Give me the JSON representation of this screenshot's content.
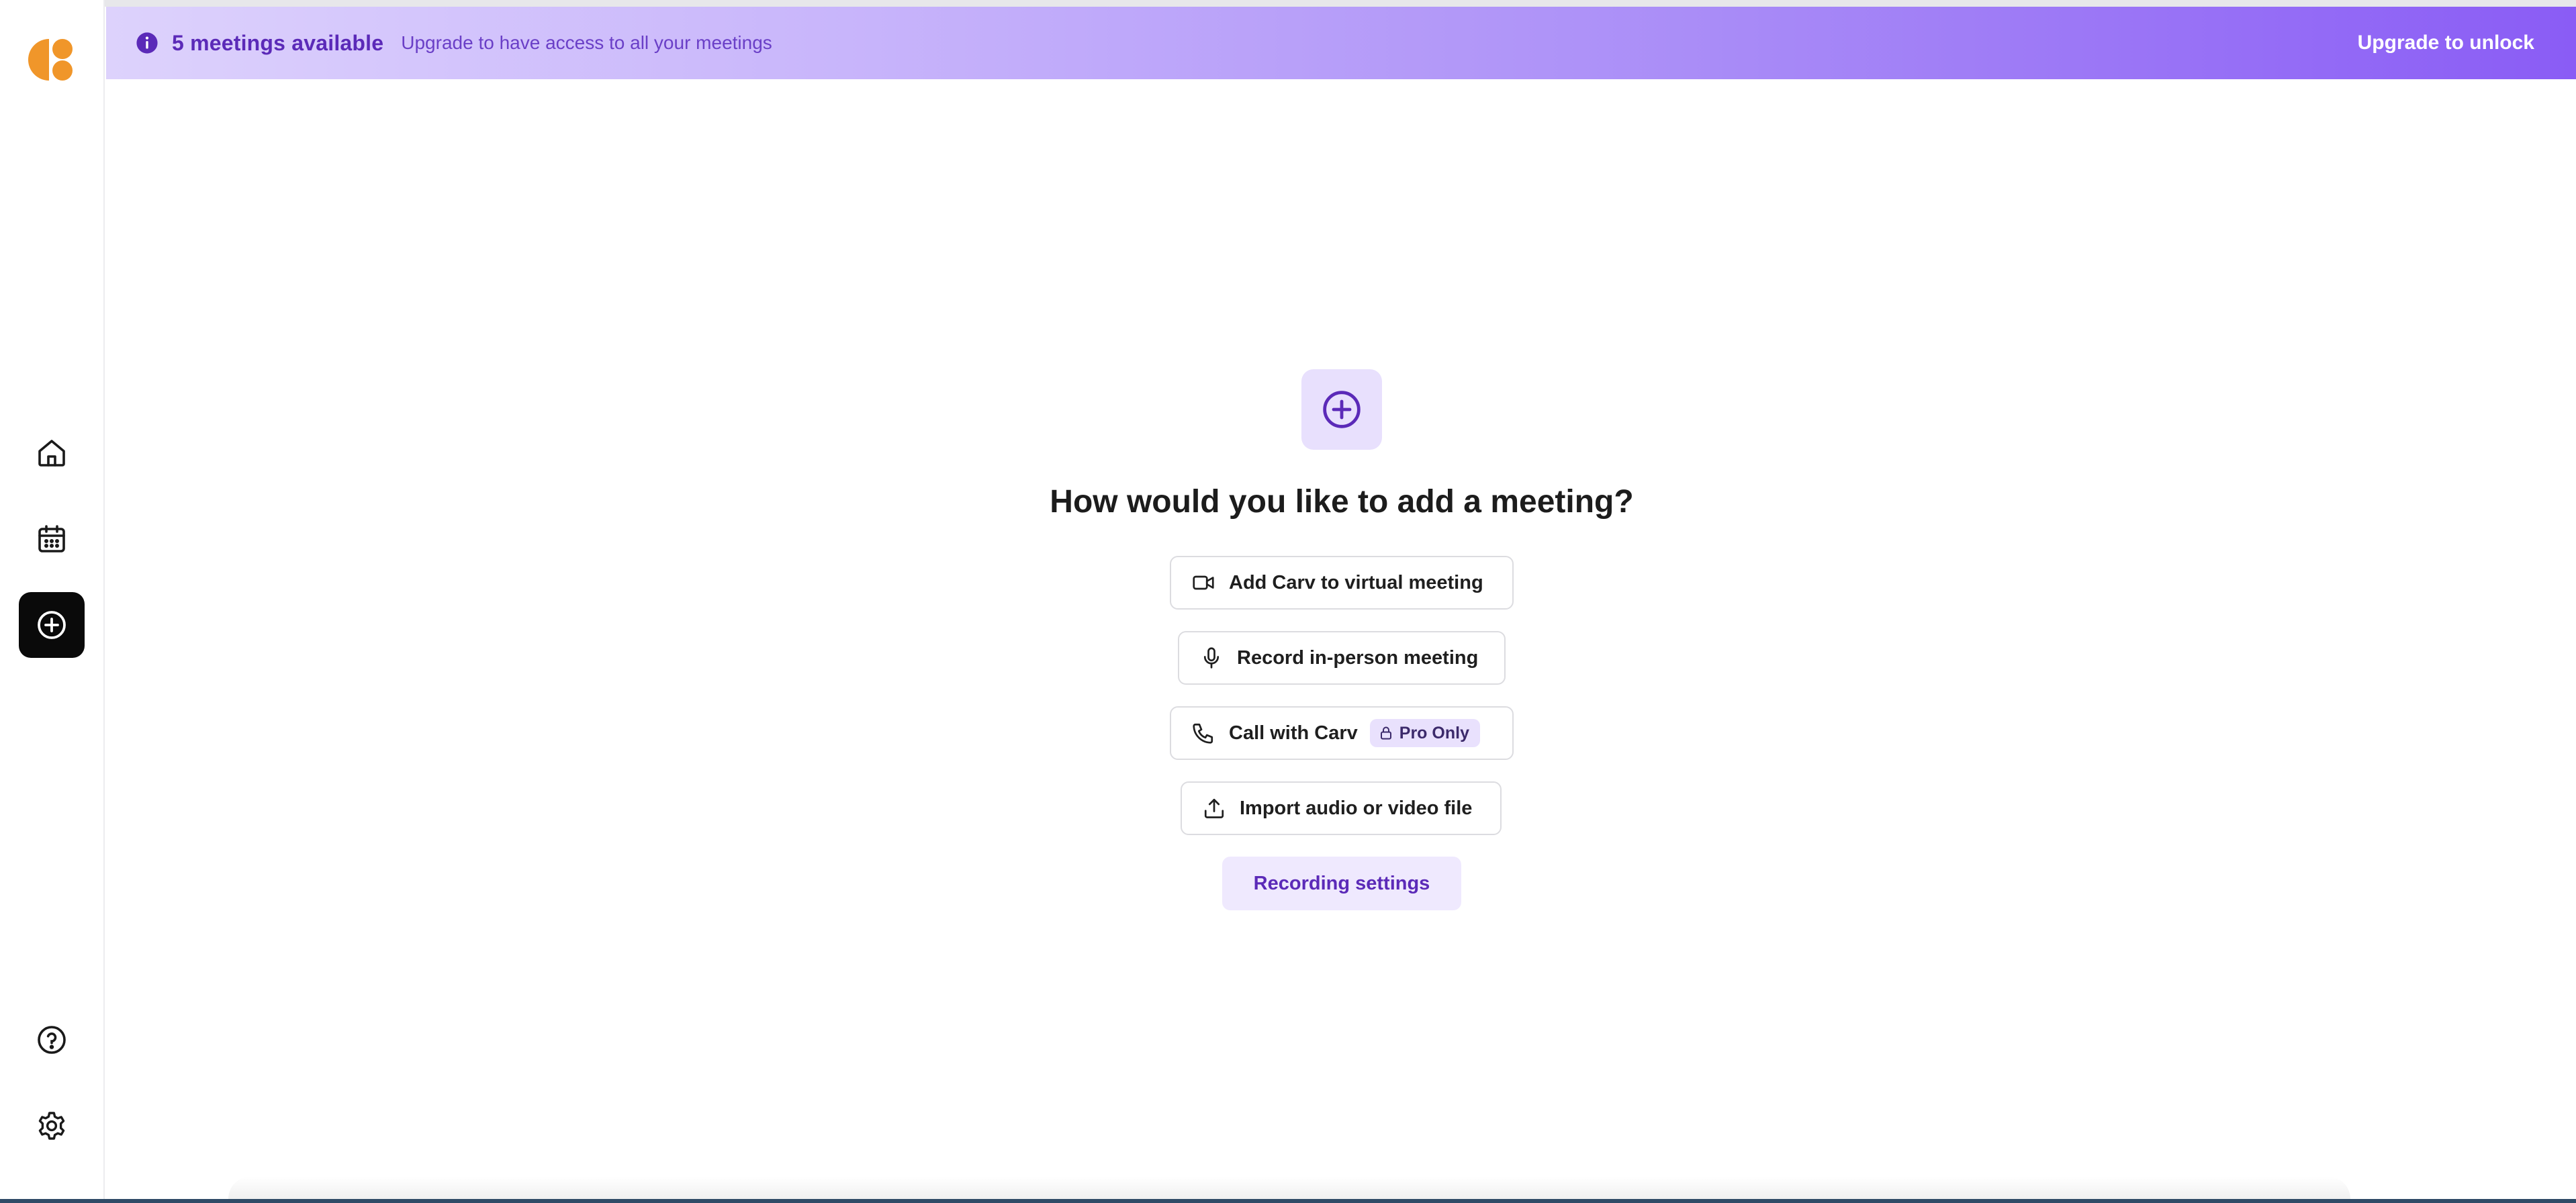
{
  "colors": {
    "accent": "#5b2ab8",
    "logo": "#f0962a",
    "banner_start": "#ddd2fc",
    "banner_end": "#8a5cf5",
    "active_nav": "#0a0a0a"
  },
  "sidebar": {
    "logo_icon": "carv-logo",
    "items": [
      {
        "icon": "home-icon"
      },
      {
        "icon": "calendar-icon"
      },
      {
        "icon": "plus-circle-icon",
        "active": true
      },
      {
        "icon": "help-icon"
      },
      {
        "icon": "gear-icon"
      }
    ]
  },
  "banner": {
    "icon": "info-icon",
    "title": "5 meetings available",
    "subtitle": "Upgrade to have access to all your meetings",
    "cta": "Upgrade to unlock"
  },
  "main": {
    "hero_icon": "plus-circle-icon",
    "heading": "How would you like to add a meeting?",
    "options": [
      {
        "label": "Add Carv to virtual meeting",
        "icon": "video-icon"
      },
      {
        "label": "Record in-person meeting",
        "icon": "microphone-icon"
      },
      {
        "label": "Call with Carv",
        "icon": "phone-icon",
        "badge": "Pro Only",
        "badge_icon": "lock-icon"
      },
      {
        "label": "Import audio or video file",
        "icon": "upload-icon"
      }
    ],
    "settings_label": "Recording settings"
  }
}
